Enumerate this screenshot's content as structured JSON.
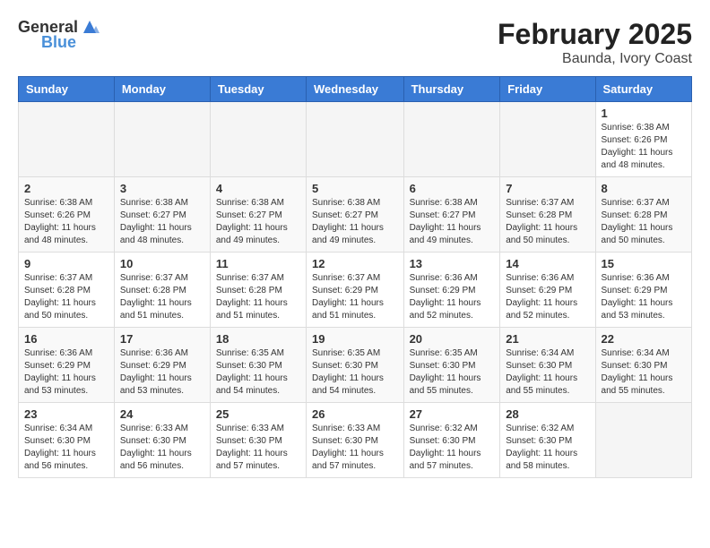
{
  "header": {
    "logo_general": "General",
    "logo_blue": "Blue",
    "title": "February 2025",
    "location": "Baunda, Ivory Coast"
  },
  "calendar": {
    "days_of_week": [
      "Sunday",
      "Monday",
      "Tuesday",
      "Wednesday",
      "Thursday",
      "Friday",
      "Saturday"
    ],
    "weeks": [
      {
        "days": [
          {
            "number": "",
            "info": ""
          },
          {
            "number": "",
            "info": ""
          },
          {
            "number": "",
            "info": ""
          },
          {
            "number": "",
            "info": ""
          },
          {
            "number": "",
            "info": ""
          },
          {
            "number": "",
            "info": ""
          },
          {
            "number": "1",
            "info": "Sunrise: 6:38 AM\nSunset: 6:26 PM\nDaylight: 11 hours\nand 48 minutes."
          }
        ]
      },
      {
        "days": [
          {
            "number": "2",
            "info": "Sunrise: 6:38 AM\nSunset: 6:26 PM\nDaylight: 11 hours\nand 48 minutes."
          },
          {
            "number": "3",
            "info": "Sunrise: 6:38 AM\nSunset: 6:27 PM\nDaylight: 11 hours\nand 48 minutes."
          },
          {
            "number": "4",
            "info": "Sunrise: 6:38 AM\nSunset: 6:27 PM\nDaylight: 11 hours\nand 49 minutes."
          },
          {
            "number": "5",
            "info": "Sunrise: 6:38 AM\nSunset: 6:27 PM\nDaylight: 11 hours\nand 49 minutes."
          },
          {
            "number": "6",
            "info": "Sunrise: 6:38 AM\nSunset: 6:27 PM\nDaylight: 11 hours\nand 49 minutes."
          },
          {
            "number": "7",
            "info": "Sunrise: 6:37 AM\nSunset: 6:28 PM\nDaylight: 11 hours\nand 50 minutes."
          },
          {
            "number": "8",
            "info": "Sunrise: 6:37 AM\nSunset: 6:28 PM\nDaylight: 11 hours\nand 50 minutes."
          }
        ]
      },
      {
        "days": [
          {
            "number": "9",
            "info": "Sunrise: 6:37 AM\nSunset: 6:28 PM\nDaylight: 11 hours\nand 50 minutes."
          },
          {
            "number": "10",
            "info": "Sunrise: 6:37 AM\nSunset: 6:28 PM\nDaylight: 11 hours\nand 51 minutes."
          },
          {
            "number": "11",
            "info": "Sunrise: 6:37 AM\nSunset: 6:28 PM\nDaylight: 11 hours\nand 51 minutes."
          },
          {
            "number": "12",
            "info": "Sunrise: 6:37 AM\nSunset: 6:29 PM\nDaylight: 11 hours\nand 51 minutes."
          },
          {
            "number": "13",
            "info": "Sunrise: 6:36 AM\nSunset: 6:29 PM\nDaylight: 11 hours\nand 52 minutes."
          },
          {
            "number": "14",
            "info": "Sunrise: 6:36 AM\nSunset: 6:29 PM\nDaylight: 11 hours\nand 52 minutes."
          },
          {
            "number": "15",
            "info": "Sunrise: 6:36 AM\nSunset: 6:29 PM\nDaylight: 11 hours\nand 53 minutes."
          }
        ]
      },
      {
        "days": [
          {
            "number": "16",
            "info": "Sunrise: 6:36 AM\nSunset: 6:29 PM\nDaylight: 11 hours\nand 53 minutes."
          },
          {
            "number": "17",
            "info": "Sunrise: 6:36 AM\nSunset: 6:29 PM\nDaylight: 11 hours\nand 53 minutes."
          },
          {
            "number": "18",
            "info": "Sunrise: 6:35 AM\nSunset: 6:30 PM\nDaylight: 11 hours\nand 54 minutes."
          },
          {
            "number": "19",
            "info": "Sunrise: 6:35 AM\nSunset: 6:30 PM\nDaylight: 11 hours\nand 54 minutes."
          },
          {
            "number": "20",
            "info": "Sunrise: 6:35 AM\nSunset: 6:30 PM\nDaylight: 11 hours\nand 55 minutes."
          },
          {
            "number": "21",
            "info": "Sunrise: 6:34 AM\nSunset: 6:30 PM\nDaylight: 11 hours\nand 55 minutes."
          },
          {
            "number": "22",
            "info": "Sunrise: 6:34 AM\nSunset: 6:30 PM\nDaylight: 11 hours\nand 55 minutes."
          }
        ]
      },
      {
        "days": [
          {
            "number": "23",
            "info": "Sunrise: 6:34 AM\nSunset: 6:30 PM\nDaylight: 11 hours\nand 56 minutes."
          },
          {
            "number": "24",
            "info": "Sunrise: 6:33 AM\nSunset: 6:30 PM\nDaylight: 11 hours\nand 56 minutes."
          },
          {
            "number": "25",
            "info": "Sunrise: 6:33 AM\nSunset: 6:30 PM\nDaylight: 11 hours\nand 57 minutes."
          },
          {
            "number": "26",
            "info": "Sunrise: 6:33 AM\nSunset: 6:30 PM\nDaylight: 11 hours\nand 57 minutes."
          },
          {
            "number": "27",
            "info": "Sunrise: 6:32 AM\nSunset: 6:30 PM\nDaylight: 11 hours\nand 57 minutes."
          },
          {
            "number": "28",
            "info": "Sunrise: 6:32 AM\nSunset: 6:30 PM\nDaylight: 11 hours\nand 58 minutes."
          },
          {
            "number": "",
            "info": ""
          }
        ]
      }
    ]
  }
}
